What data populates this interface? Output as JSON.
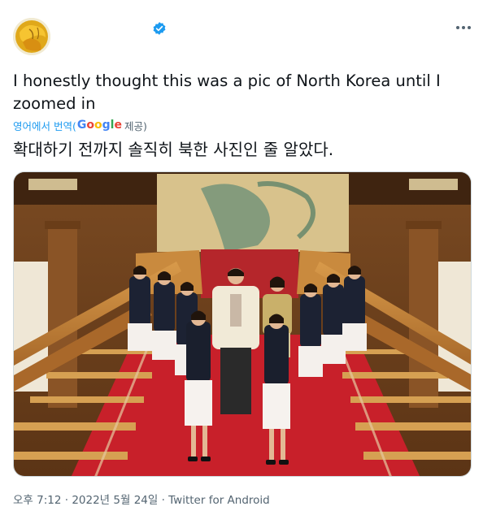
{
  "tweet": {
    "text_original": "I honestly thought this was a pic of North Korea until I zoomed in",
    "translate_prefix": "영어에서 번역(",
    "translate_brand": "Google",
    "translate_suffix": " 제공)",
    "text_translated": "확대하기 전까지 솔직히 북한 사진인 줄 알았다.",
    "meta": "오후 7:12 · 2022년 5월 24일 · Twitter for Android"
  },
  "colors": {
    "link": "#1d9bf0",
    "secondary": "#536471",
    "carpet": "#c8202a",
    "wood": "#b8772e"
  },
  "icons": {
    "verified": "verified-badge-icon",
    "more": "more-dots-icon"
  }
}
